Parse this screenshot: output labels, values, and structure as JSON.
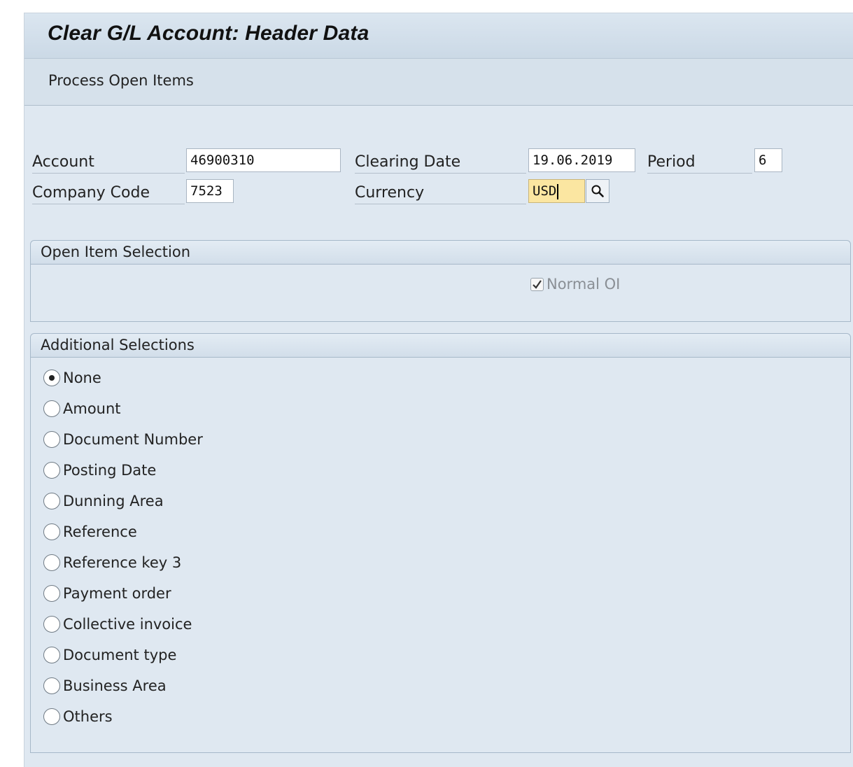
{
  "title": "Clear G/L Account: Header Data",
  "toolbar": {
    "process_open_items": "Process Open Items"
  },
  "header_fields": {
    "account_label": "Account",
    "account_value": "46900310",
    "company_code_label": "Company Code",
    "company_code_value": "7523",
    "clearing_date_label": "Clearing Date",
    "clearing_date_value": "19.06.2019",
    "period_label": "Period",
    "period_value": "6",
    "currency_label": "Currency",
    "currency_value": "USD"
  },
  "open_item_selection": {
    "title": "Open Item Selection",
    "normal_oi_label": "Normal OI",
    "normal_oi_checked": true
  },
  "additional_selections": {
    "title": "Additional Selections",
    "options": [
      "None",
      "Amount",
      "Document Number",
      "Posting Date",
      "Dunning Area",
      "Reference",
      "Reference key 3",
      "Payment order",
      "Collective invoice",
      "Document type",
      "Business Area",
      "Others"
    ],
    "selected": "None"
  },
  "icons": {
    "value_help": "search-icon",
    "checkbox": "checkmark-icon"
  },
  "colors": {
    "focused_field": "#fbe6a1",
    "background": "#dfe8f1"
  }
}
